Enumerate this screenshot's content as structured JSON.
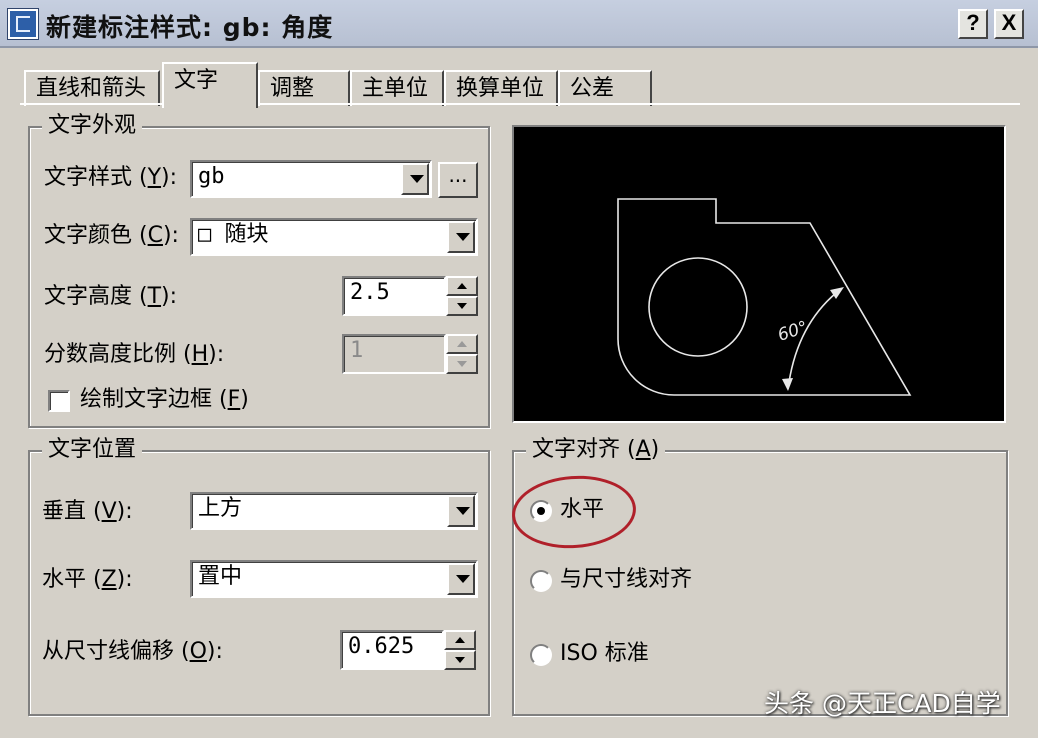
{
  "window": {
    "title": "新建标注样式: gb: 角度",
    "help_btn": "?",
    "close_btn": "X"
  },
  "tabs": [
    "直线和箭头",
    "文字",
    "调整",
    "主单位",
    "换算单位",
    "公差"
  ],
  "active_tab": "文字",
  "text_appearance": {
    "legend": "文字外观",
    "style_label": "文字样式",
    "style_key": "Y",
    "style_value": "gb",
    "style_browse": "...",
    "color_label": "文字颜色",
    "color_key": "C",
    "color_value": "□ 随块",
    "height_label": "文字高度",
    "height_key": "T",
    "height_value": "2.5",
    "fraction_label": "分数高度比例",
    "fraction_key": "H",
    "fraction_value": "1",
    "frame_label": "绘制文字边框",
    "frame_key": "F",
    "frame_checked": false
  },
  "text_position": {
    "legend": "文字位置",
    "vertical_label": "垂直",
    "vertical_key": "V",
    "vertical_value": "上方",
    "horizontal_label": "水平",
    "horizontal_key": "Z",
    "horizontal_value": "置中",
    "offset_label": "从尺寸线偏移",
    "offset_key": "O",
    "offset_value": "0.625"
  },
  "text_alignment": {
    "legend": "文字对齐",
    "legend_key": "A",
    "options": [
      "水平",
      "与尺寸线对齐",
      "ISO 标准"
    ],
    "selected": "水平"
  },
  "preview": {
    "angle_label": "60°",
    "line_color": "#e8e8e8"
  },
  "watermark": "头条 @天正CAD自学",
  "colors": {
    "dialog_bg": "#d4d0c8",
    "titlebar": "#c0c9da",
    "highlight_ring": "#b0202a"
  }
}
